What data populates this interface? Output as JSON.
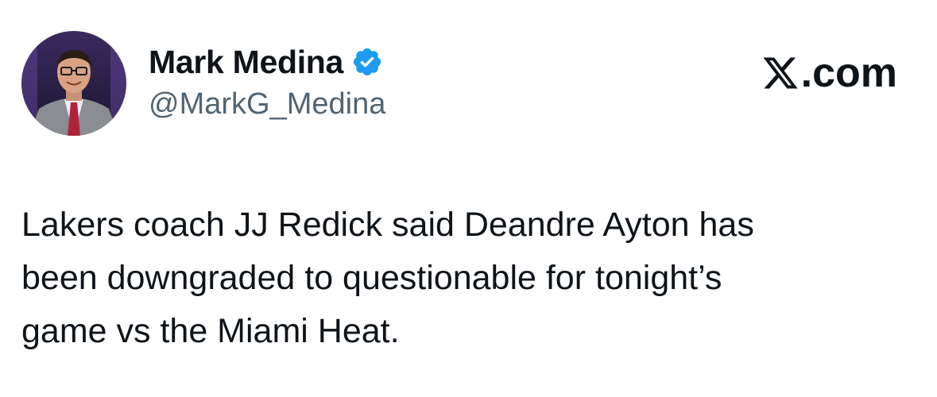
{
  "author": {
    "name": "Mark Medina",
    "handle": "@MarkG_Medina",
    "verified": true,
    "avatar_icon": "profile-photo"
  },
  "brand": {
    "suffix": ".com",
    "icon": "x-logo-icon"
  },
  "tweet": {
    "lines": [
      "Lakers coach JJ Redick said Deandre Ayton has",
      "been downgraded to questionable for tonight’s",
      "game vs the Miami Heat."
    ]
  },
  "colors": {
    "text": "#0f1419",
    "secondary_text": "#536471",
    "verified_badge": "#1d9bf0",
    "background": "#ffffff"
  }
}
